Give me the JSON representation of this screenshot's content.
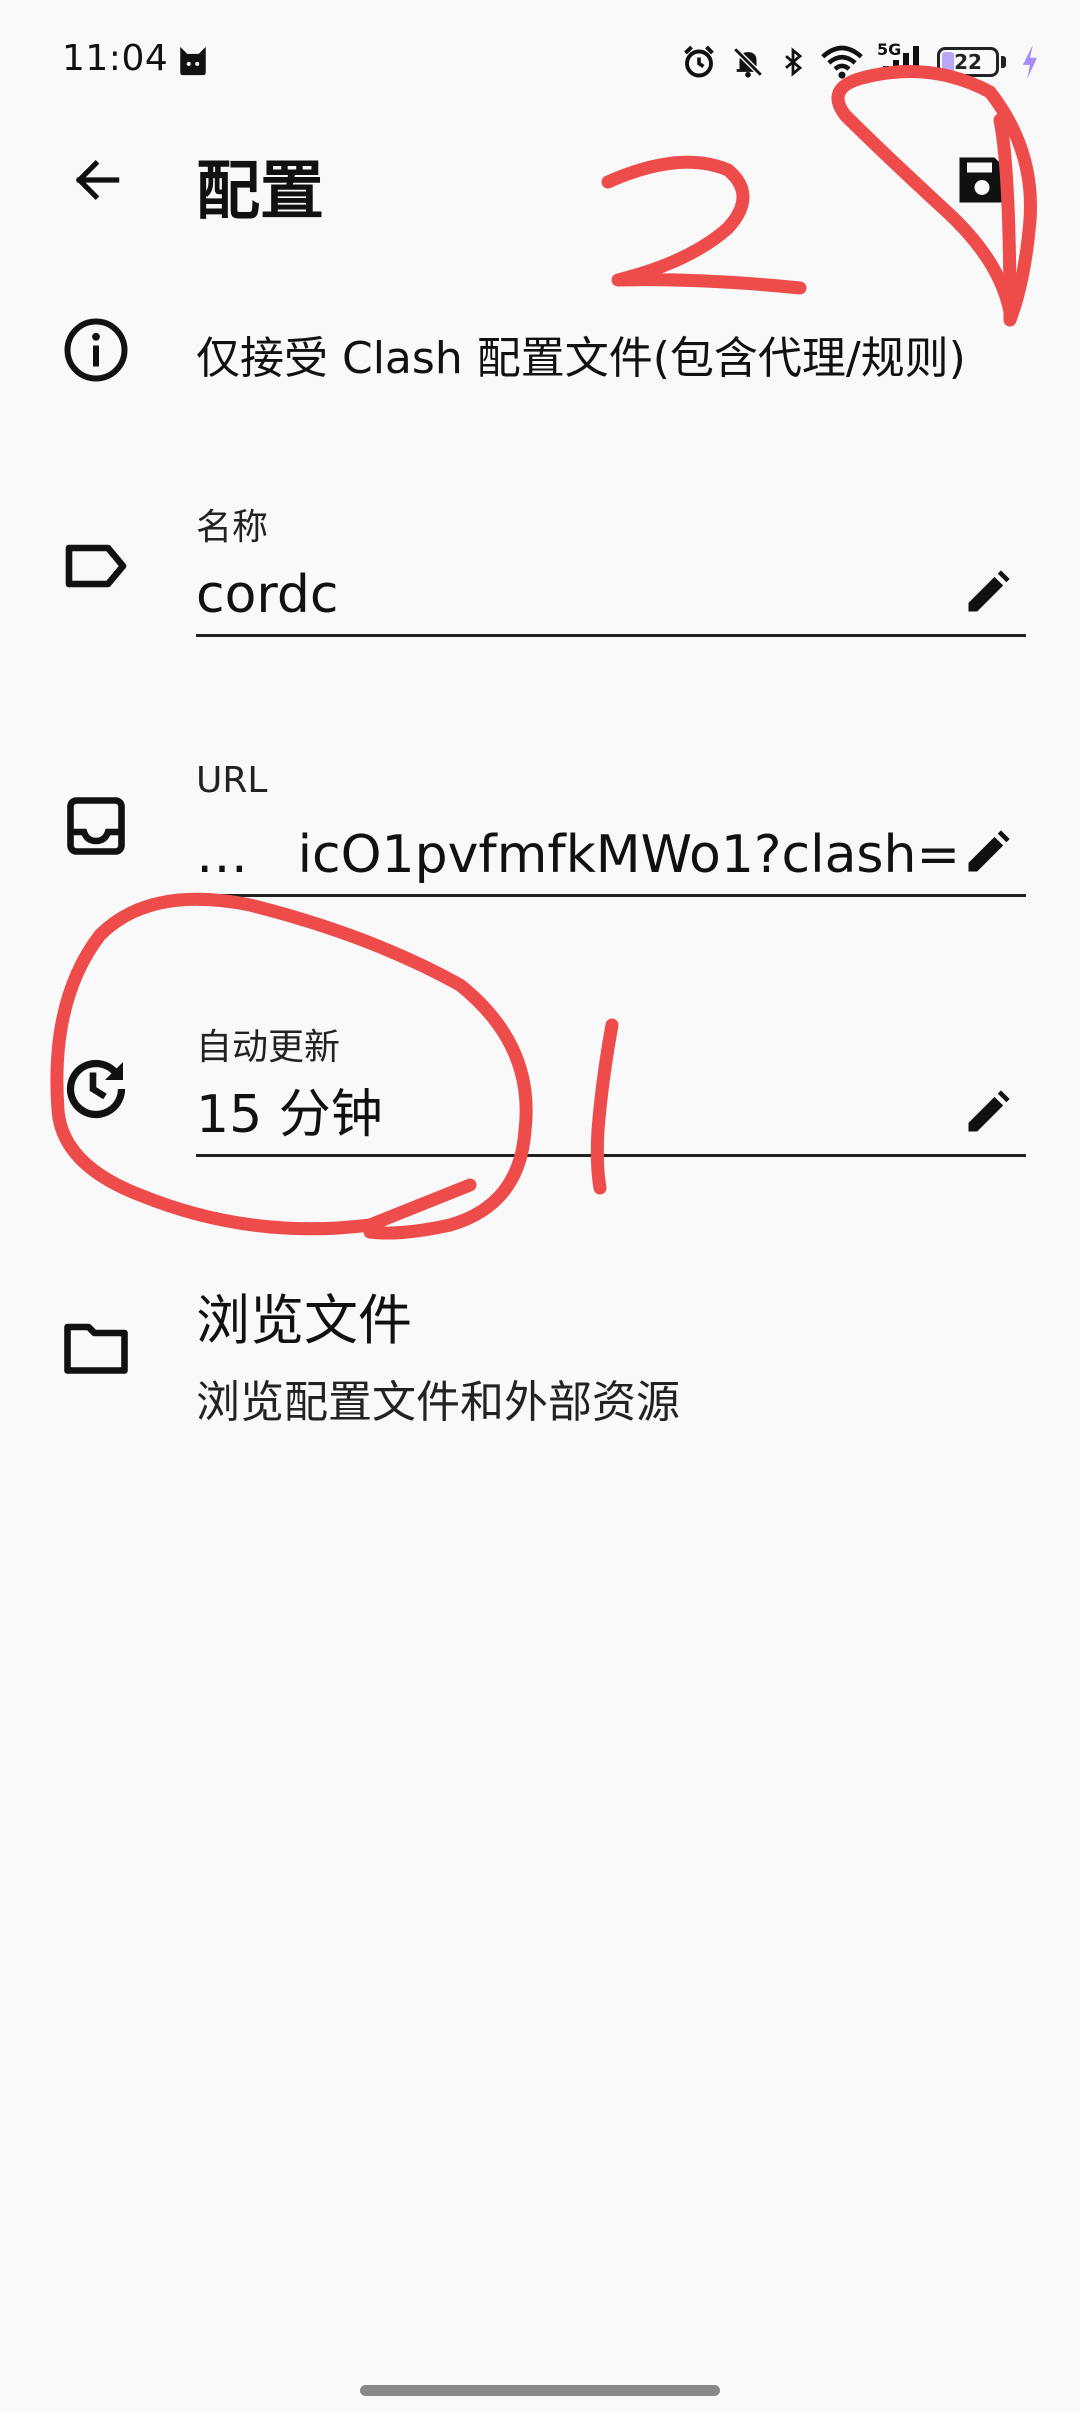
{
  "status_bar": {
    "time": "11:04",
    "network": "5G",
    "battery": "22"
  },
  "app_bar": {
    "title": "配置"
  },
  "info": {
    "text": "仅接受 Clash 配置文件(包含代理/规则)"
  },
  "fields": {
    "name": {
      "label": "名称",
      "value": "cordc"
    },
    "url": {
      "label": "URL",
      "value": "…   icO1pvfmfkMWo1?clash="
    },
    "auto_update": {
      "label": "自动更新",
      "value": "15 分钟"
    }
  },
  "browse": {
    "title": "浏览文件",
    "subtitle": "浏览配置文件和外部资源"
  },
  "annotations": {
    "left_mark": "1",
    "top_mark": "29"
  },
  "colors": {
    "annotation": "#ee4b4b",
    "battery_fill": "#b9a6f5",
    "charging": "#a78bfa"
  },
  "icons": [
    "back-arrow",
    "save-floppy",
    "info",
    "label-tag",
    "inbox-tray",
    "history-clock",
    "folder",
    "pencil-edit"
  ]
}
